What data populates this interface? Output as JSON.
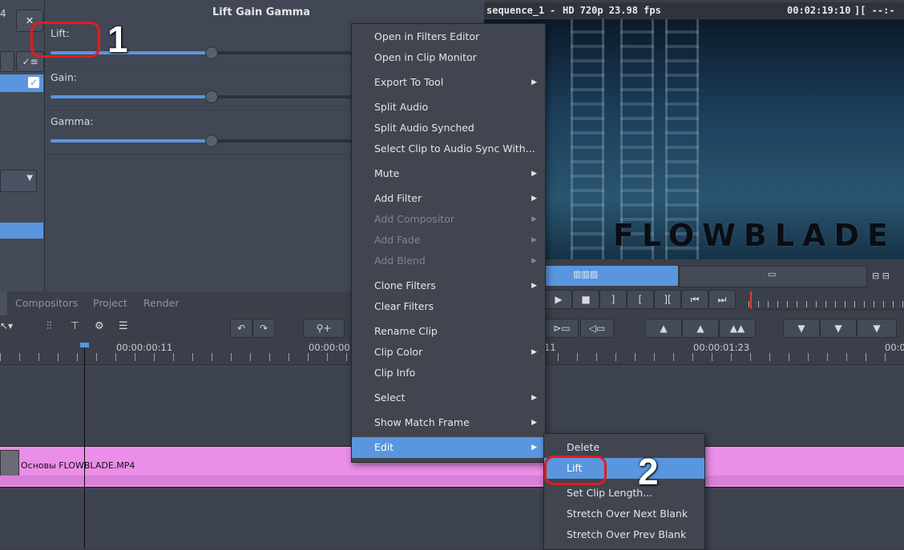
{
  "filter_panel": {
    "title": "Lift Gain Gamma",
    "close_glyph": "✕",
    "params": [
      {
        "label": "Lift:",
        "level": 0.53
      },
      {
        "label": "Gain:",
        "level": 0.53
      },
      {
        "label": "Gamma:",
        "level": 0.53
      }
    ]
  },
  "left_strip": {
    "top_digit": "4"
  },
  "monitor": {
    "sequence": "sequence_1",
    "format": "HD 720p 23.98 fps",
    "timecode": "00:02:19:10",
    "marks": "][ --:--:--:-",
    "watermark": "FLOWBLADE"
  },
  "tabs": [
    "Compositors",
    "Project",
    "Render"
  ],
  "ruler": {
    "labels": [
      "00:00:00:11",
      "00:00:00:",
      "11",
      "00:00:01:23",
      "00:0"
    ]
  },
  "clip": {
    "name": "Основы FLOWBLADE.MP4",
    "color": "#ea8ee8"
  },
  "context_menu": {
    "items": [
      {
        "label": "Open in Filters Editor",
        "submenu": false,
        "disabled": false
      },
      {
        "label": "Open in Clip Monitor",
        "submenu": false,
        "disabled": false
      },
      {
        "label": "Export To Tool",
        "submenu": true,
        "disabled": false
      },
      {
        "label": "Split Audio",
        "submenu": false,
        "disabled": false
      },
      {
        "label": "Split Audio Synched",
        "submenu": false,
        "disabled": false
      },
      {
        "label": "Select Clip to Audio Sync With...",
        "submenu": false,
        "disabled": false
      },
      {
        "label": "Mute",
        "submenu": true,
        "disabled": false
      },
      {
        "label": "Add Filter",
        "submenu": true,
        "disabled": false
      },
      {
        "label": "Add Compositor",
        "submenu": true,
        "disabled": true
      },
      {
        "label": "Add Fade",
        "submenu": true,
        "disabled": true
      },
      {
        "label": "Add Blend",
        "submenu": true,
        "disabled": true
      },
      {
        "label": "Clone Filters",
        "submenu": true,
        "disabled": false
      },
      {
        "label": "Clear Filters",
        "submenu": false,
        "disabled": false
      },
      {
        "label": "Rename Clip",
        "submenu": false,
        "disabled": false
      },
      {
        "label": "Clip Color",
        "submenu": true,
        "disabled": false
      },
      {
        "label": "Clip Info",
        "submenu": false,
        "disabled": false
      },
      {
        "label": "Select",
        "submenu": true,
        "disabled": false
      },
      {
        "label": "Show Match Frame",
        "submenu": true,
        "disabled": false
      },
      {
        "label": "Edit",
        "submenu": true,
        "disabled": false,
        "active": true
      }
    ],
    "arrow_glyph": "▶"
  },
  "edit_submenu": {
    "items": [
      {
        "label": "Delete"
      },
      {
        "label": "Lift",
        "active": true
      },
      {
        "label": "Set Clip Length..."
      },
      {
        "label": "Stretch Over Next Blank"
      },
      {
        "label": "Stretch Over Prev Blank"
      }
    ]
  },
  "annotations": {
    "step1": "1",
    "step2": "2"
  },
  "colors": {
    "accent": "#5a96de",
    "annotation": "#e51b1b"
  }
}
